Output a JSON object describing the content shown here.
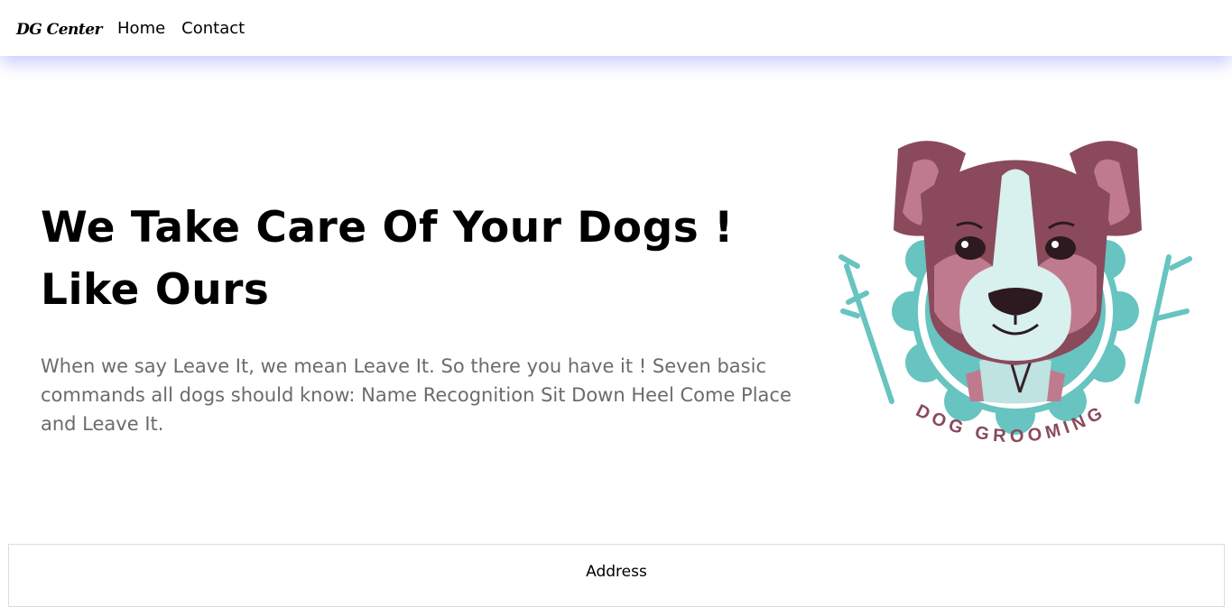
{
  "nav": {
    "brand": "DG Center",
    "links": [
      "Home",
      "Contact"
    ]
  },
  "hero": {
    "title_line1": "We Take Care Of Your Dogs !",
    "title_line2": "Like Ours",
    "description": "When we say Leave It, we mean Leave It. So there you have it ! Seven basic commands all dogs should know: Name Recognition Sit Down Heel Come Place and Leave It."
  },
  "logo": {
    "icon": "dog-grooming-logo",
    "caption": "DOG GROOMING"
  },
  "footer": {
    "address_label": "Address"
  },
  "colors": {
    "teal": "#67c4c0",
    "fur_dark": "#8a4a5c",
    "fur_light": "#c07a8e",
    "muzzle": "#d8f0ee"
  }
}
